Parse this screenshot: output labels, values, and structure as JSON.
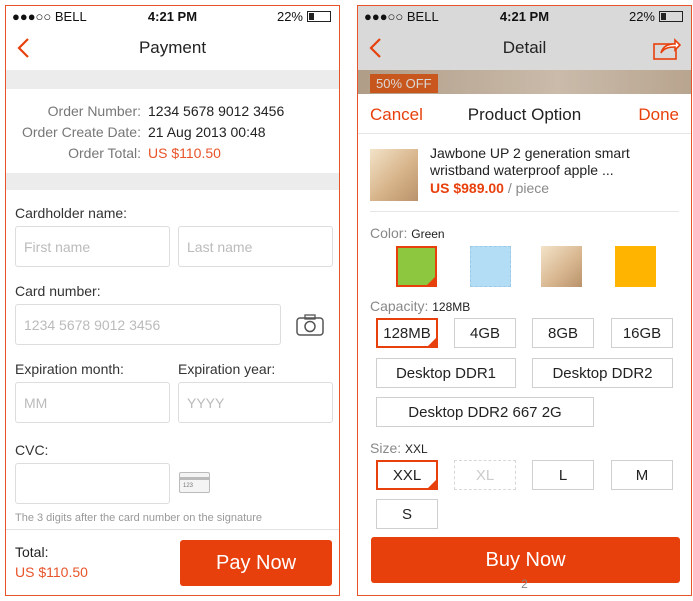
{
  "left_screen": {
    "status": {
      "carrier": "●●●○○ BELL",
      "time": "4:21 PM",
      "battery": "22%"
    },
    "title": "Payment",
    "order": {
      "number_label": "Order Number:",
      "number_value": "1234 5678 9012 3456",
      "date_label": "Order Create Date:",
      "date_value": "21 Aug 2013 00:48",
      "total_label": "Order Total:",
      "total_value": "US $110.50"
    },
    "cardholder_label": "Cardholder name:",
    "first_name_placeholder": "First name",
    "last_name_placeholder": "Last name",
    "card_number_label": "Card number:",
    "card_number_placeholder": "1234 5678 9012 3456",
    "exp_month_label": "Expiration month:",
    "exp_month_placeholder": "MM",
    "exp_year_label": "Expiration year:",
    "exp_year_placeholder": "YYYY",
    "cvc_label": "CVC:",
    "cvc_card_text": "123",
    "cvc_hint": "The 3 digits after the card number on the signature",
    "total_label": "Total:",
    "total_value": "US $110.50",
    "pay_button": "Pay Now"
  },
  "right_screen": {
    "status": {
      "carrier": "●●●○○ BELL",
      "time": "4:21 PM",
      "battery": "22%"
    },
    "title": "Detail",
    "badge": "50% OFF",
    "sheet": {
      "cancel": "Cancel",
      "title": "Product Option",
      "done": "Done",
      "product_name": "Jawbone UP 2 generation smart wristband waterproof apple ...",
      "price": "US $989.00",
      "unit": " / piece",
      "color_label": "Color:",
      "color_value": "Green",
      "swatches": [
        "#8dc63f",
        "#b3dcf5",
        "#d9b892",
        "#ffb400"
      ],
      "capacity_label": "Capacity:",
      "capacity_value": "128MB",
      "capacity_options": [
        "128MB",
        "4GB",
        "8GB",
        "16GB",
        "Desktop DDR1",
        "Desktop DDR2",
        "Desktop DDR2 667 2G"
      ],
      "size_label": "Size:",
      "size_value": "XXL",
      "size_options": [
        "XXL",
        "XL",
        "L",
        "M",
        "S"
      ],
      "buy_button": "Buy Now",
      "page_number": "2"
    }
  },
  "colors": {
    "accent": "#e8400c",
    "price": "#e8542a"
  }
}
